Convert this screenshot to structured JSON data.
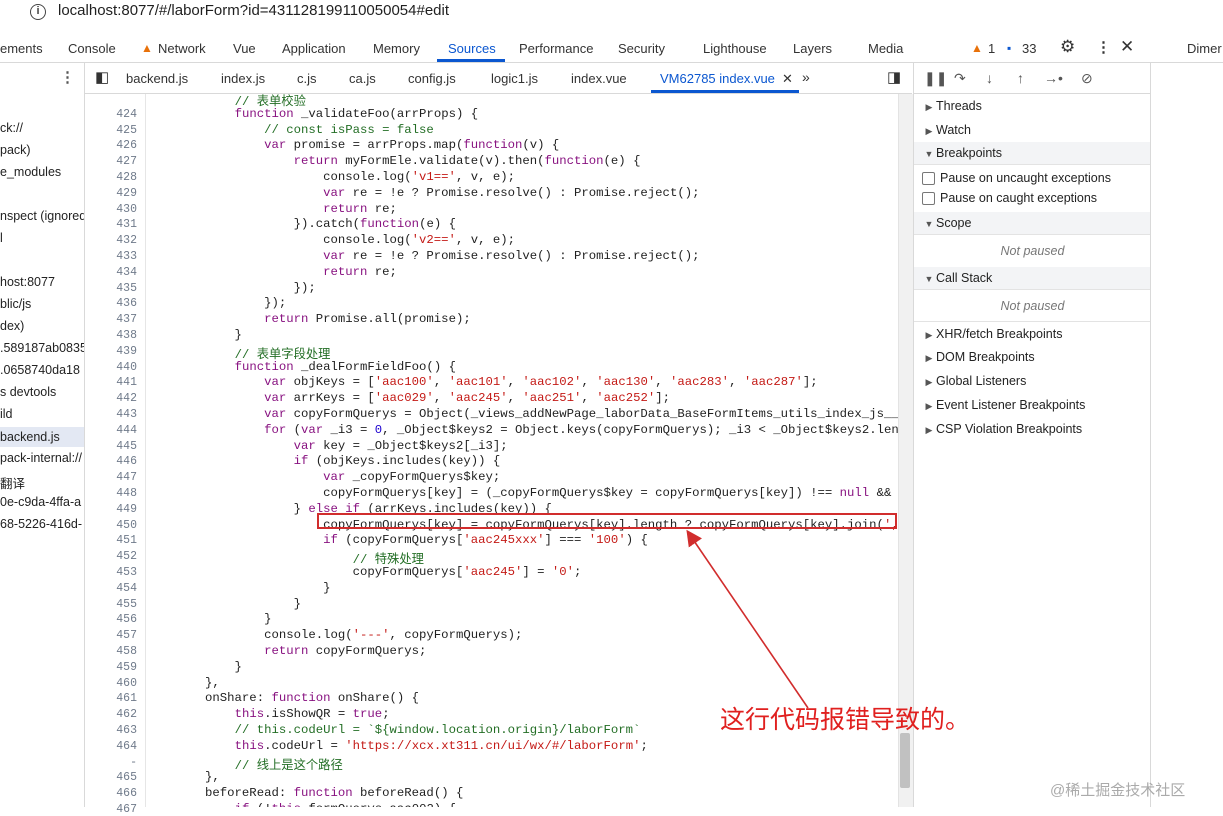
{
  "browser": {
    "url": "localhost:8077/#/laborForm?id=431128199110050054#edit"
  },
  "devtools_tabs": [
    "ements",
    "Console",
    "Network",
    "Vue",
    "Application",
    "Memory",
    "Sources",
    "Performance",
    "Security",
    "Lighthouse",
    "Layers",
    "Media"
  ],
  "active_tab": "Sources",
  "toolbar": {
    "warn_count": "1",
    "msg_count": "33",
    "dimen_label": "Dimer"
  },
  "sidebar_items": [
    "ck://",
    "pack)",
    "e_modules",
    "nspect (ignored",
    "l",
    "host:8077",
    "blic/js",
    "dex)",
    ".589187ab0835",
    ".0658740da18",
    "s devtools",
    "ild",
    "backend.js",
    "pack-internal://",
    "翻译",
    "0e-c9da-4ffa-a",
    "68-5226-416d-"
  ],
  "file_tabs": [
    "backend.js",
    "index.js",
    "c.js",
    "ca.js",
    "config.js",
    "logic1.js",
    "index.vue",
    "VM62785 index.vue"
  ],
  "code_lines": [
    {
      "n": "",
      "t": "            // 表单校验"
    },
    {
      "n": "424",
      "t": "            function _validateFoo(arrProps) {"
    },
    {
      "n": "425",
      "t": "                // const isPass = false"
    },
    {
      "n": "426",
      "t": "                var promise = arrProps.map(function(v) {"
    },
    {
      "n": "427",
      "t": "                    return myFormEle.validate(v).then(function(e) {"
    },
    {
      "n": "428",
      "t": "                        console.log('v1==', v, e);"
    },
    {
      "n": "429",
      "t": "                        var re = !e ? Promise.resolve() : Promise.reject();"
    },
    {
      "n": "430",
      "t": "                        return re;"
    },
    {
      "n": "431",
      "t": "                    }).catch(function(e) {"
    },
    {
      "n": "432",
      "t": "                        console.log('v2==', v, e);"
    },
    {
      "n": "433",
      "t": "                        var re = !e ? Promise.resolve() : Promise.reject();"
    },
    {
      "n": "434",
      "t": "                        return re;"
    },
    {
      "n": "435",
      "t": "                    });"
    },
    {
      "n": "436",
      "t": "                });"
    },
    {
      "n": "437",
      "t": "                return Promise.all(promise);"
    },
    {
      "n": "438",
      "t": "            }"
    },
    {
      "n": "439",
      "t": "            // 表单字段处理"
    },
    {
      "n": "440",
      "t": "            function _dealFormFieldFoo() {"
    },
    {
      "n": "441",
      "t": "                var objKeys = ['aac100', 'aac101', 'aac102', 'aac130', 'aac283', 'aac287'];"
    },
    {
      "n": "442",
      "t": "                var arrKeys = ['aac029', 'aac245', 'aac251', 'aac252'];"
    },
    {
      "n": "443",
      "t": "                var copyFormQuerys = Object(_views_addNewPage_laborData_BaseFormItems_utils_index_js__W"
    },
    {
      "n": "444",
      "t": "                for (var _i3 = 0, _Object$keys2 = Object.keys(copyFormQuerys); _i3 < _Object$keys2.leng"
    },
    {
      "n": "445",
      "t": "                    var key = _Object$keys2[_i3];"
    },
    {
      "n": "446",
      "t": "                    if (objKeys.includes(key)) {"
    },
    {
      "n": "447",
      "t": "                        var _copyFormQuerys$key;"
    },
    {
      "n": "448",
      "t": "                        copyFormQuerys[key] = (_copyFormQuerys$key = copyFormQuerys[key]) !== null && _"
    },
    {
      "n": "449",
      "t": "                    } else if (arrKeys.includes(key)) {"
    },
    {
      "n": "450",
      "t": "                        copyFormQuerys[key] = copyFormQuerys[key].length ? copyFormQuerys[key].join(',"
    },
    {
      "n": "451",
      "t": "                        if (copyFormQuerys['aac245xxx'] === '100') {"
    },
    {
      "n": "452",
      "t": "                            // 特殊处理"
    },
    {
      "n": "453",
      "t": "                            copyFormQuerys['aac245'] = '0';"
    },
    {
      "n": "454",
      "t": "                        }"
    },
    {
      "n": "455",
      "t": "                    }"
    },
    {
      "n": "456",
      "t": "                }"
    },
    {
      "n": "457",
      "t": "                console.log('---', copyFormQuerys);"
    },
    {
      "n": "458",
      "t": "                return copyFormQuerys;"
    },
    {
      "n": "459",
      "t": "            }"
    },
    {
      "n": "460",
      "t": "        },"
    },
    {
      "n": "461",
      "t": "        onShare: function onShare() {"
    },
    {
      "n": "462",
      "t": "            this.isShowQR = true;"
    },
    {
      "n": "463",
      "t": "            // this.codeUrl = `${window.location.origin}/laborForm`"
    },
    {
      "n": "464",
      "t": "            this.codeUrl = 'https://xcx.xt311.cn/ui/wx/#/laborForm';"
    },
    {
      "n": "-",
      "t": "            // 线上是这个路径"
    },
    {
      "n": "465",
      "t": "        },"
    },
    {
      "n": "466",
      "t": "        beforeRead: function beforeRead() {"
    },
    {
      "n": "467",
      "t": "            if (!this.formQuerys.aac002) {"
    }
  ],
  "right_panel": {
    "threads": "Threads",
    "watch": "Watch",
    "breakpoints": "Breakpoints",
    "pause_uncaught": "Pause on uncaught exceptions",
    "pause_caught": "Pause on caught exceptions",
    "scope": "Scope",
    "call_stack": "Call Stack",
    "not_paused": "Not paused",
    "xhr": "XHR/fetch Breakpoints",
    "dom": "DOM Breakpoints",
    "global": "Global Listeners",
    "event": "Event Listener Breakpoints",
    "csp": "CSP Violation Breakpoints"
  },
  "annotation": {
    "text": "这行代码报错导致的。",
    "color": "#e0201f"
  },
  "watermark": "@稀土掘金技术社区"
}
